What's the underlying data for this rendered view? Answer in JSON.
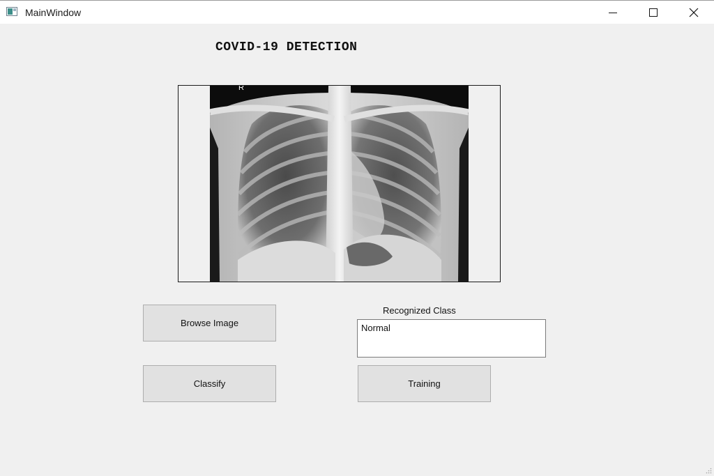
{
  "window": {
    "title": "MainWindow",
    "controls": [
      "minimize-icon",
      "maximize-icon",
      "close-icon"
    ]
  },
  "app": {
    "heading": "COVID-19 DETECTION",
    "image_marker": "R"
  },
  "buttons": {
    "browse_label": "Browse Image",
    "classify_label": "Classify",
    "training_label": "Training"
  },
  "result": {
    "label": "Recognized Class",
    "value": "Normal"
  },
  "colors": {
    "background": "#f0f0f0",
    "button_face": "#e1e1e1",
    "button_border": "#adadad"
  }
}
